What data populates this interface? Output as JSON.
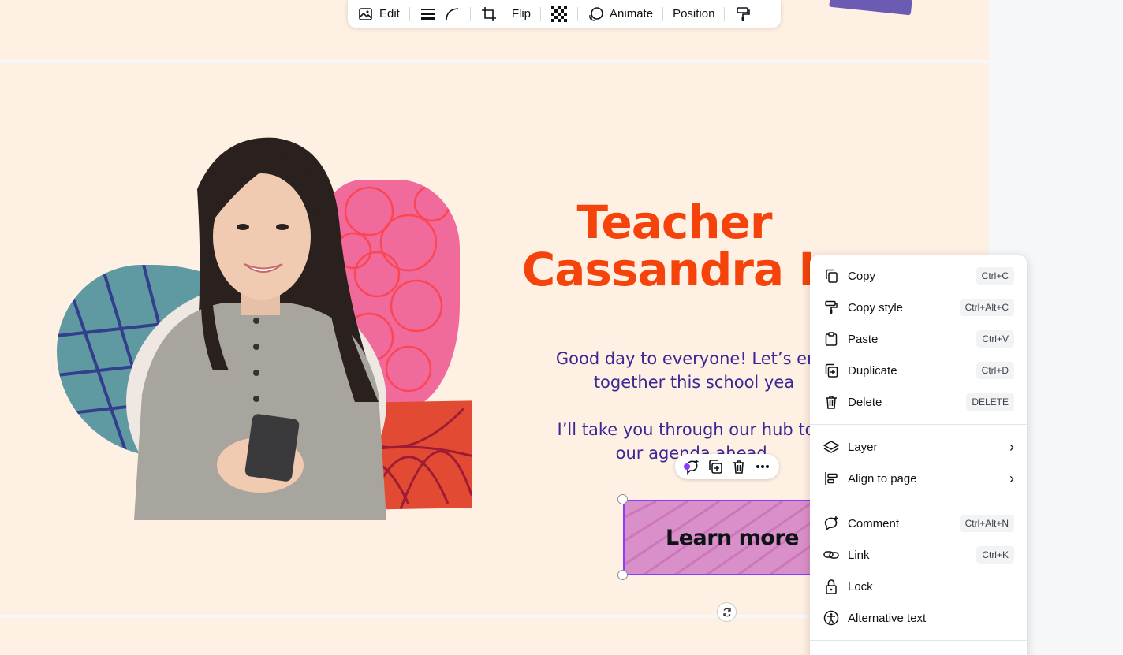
{
  "toolbar": {
    "edit": "Edit",
    "flip": "Flip",
    "animate": "Animate",
    "position": "Position"
  },
  "slide": {
    "title_line1": "Teacher",
    "title_line2": "Cassandra L",
    "para1_line1": "Good day to everyone! Let’s enjo",
    "para1_line2": "together this school yea",
    "para2_line1": "I’ll take you through our hub to g",
    "para2_line2": "our agenda ahead.",
    "button_label": "Learn more"
  },
  "context_menu": {
    "items": [
      {
        "label": "Copy",
        "shortcut": "Ctrl+C"
      },
      {
        "label": "Copy style",
        "shortcut": "Ctrl+Alt+C"
      },
      {
        "label": "Paste",
        "shortcut": "Ctrl+V"
      },
      {
        "label": "Duplicate",
        "shortcut": "Ctrl+D"
      },
      {
        "label": "Delete",
        "shortcut": "DELETE"
      },
      {
        "label": "Layer"
      },
      {
        "label": "Align to page"
      },
      {
        "label": "Comment",
        "shortcut": "Ctrl+Alt+N"
      },
      {
        "label": "Link",
        "shortcut": "Ctrl+K"
      },
      {
        "label": "Lock"
      },
      {
        "label": "Alternative text"
      }
    ]
  },
  "colors": {
    "page_bg": "#fff0e4",
    "title": "#f4440b",
    "body_text": "#3b2894",
    "selection": "#8b3dff",
    "button_fill": "#d98fc7"
  }
}
